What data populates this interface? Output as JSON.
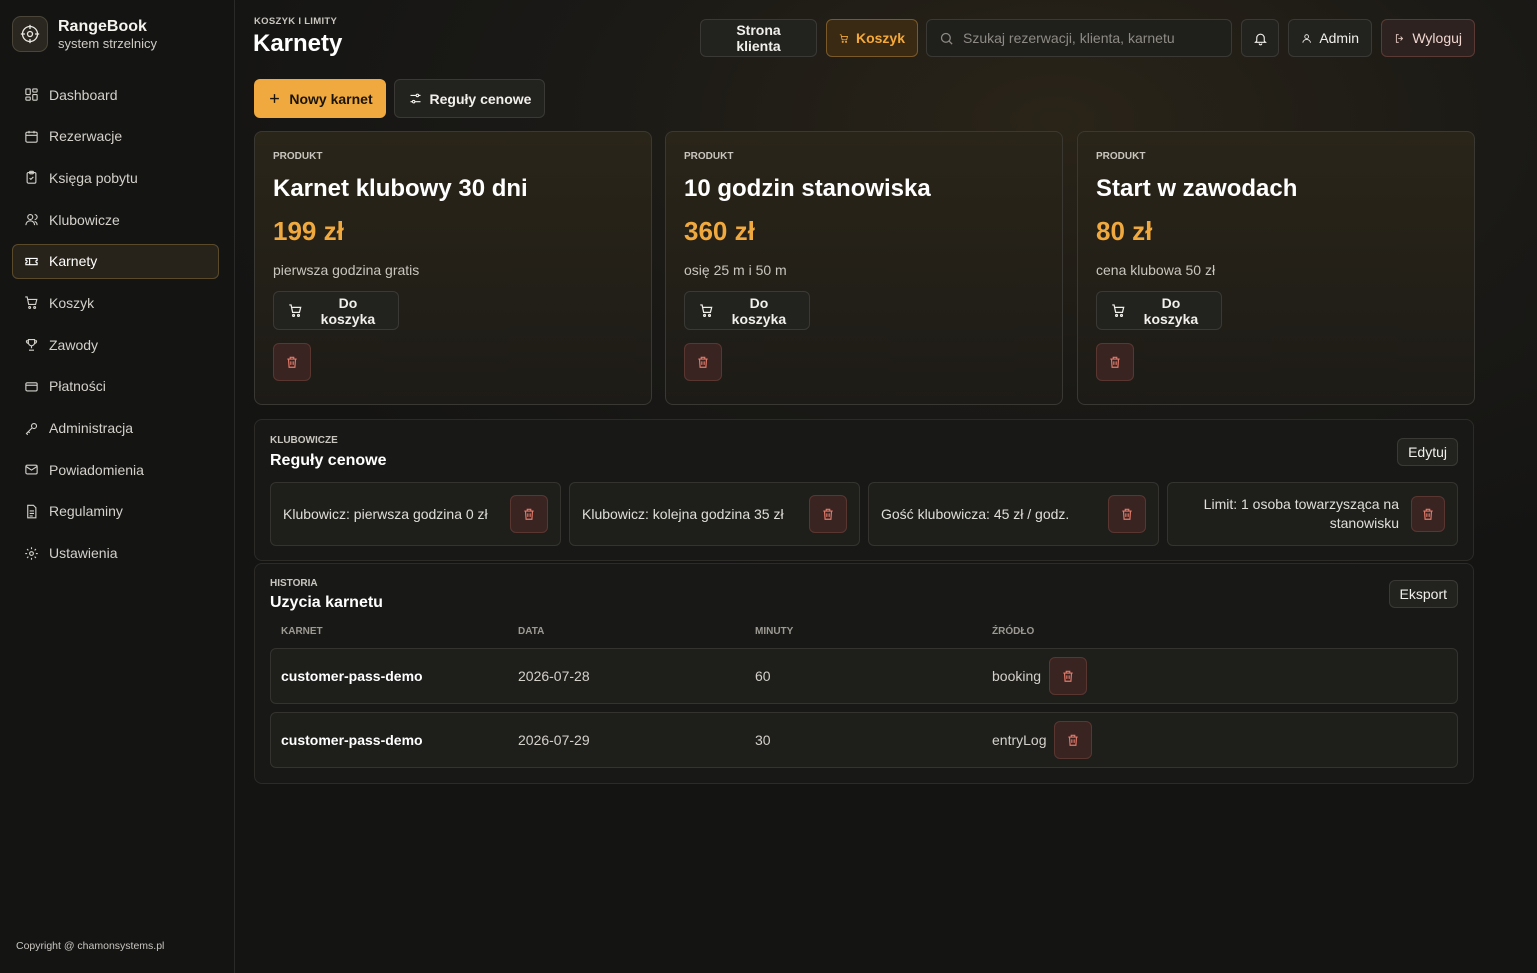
{
  "app": {
    "name": "RangeBook",
    "subtitle": "system strzelnicy"
  },
  "sidebar": {
    "items": [
      {
        "label": "Dashboard",
        "icon": "dashboard-icon"
      },
      {
        "label": "Rezerwacje",
        "icon": "calendar-icon"
      },
      {
        "label": "Księga pobytu",
        "icon": "clipboard-icon"
      },
      {
        "label": "Klubowicze",
        "icon": "user-icon"
      },
      {
        "label": "Karnety",
        "icon": "ticket-icon",
        "active": true
      },
      {
        "label": "Koszyk",
        "icon": "cart-icon"
      },
      {
        "label": "Zawody",
        "icon": "trophy-icon"
      },
      {
        "label": "Płatności",
        "icon": "wallet-icon"
      },
      {
        "label": "Administracja",
        "icon": "key-icon"
      },
      {
        "label": "Powiadomienia",
        "icon": "mail-icon"
      },
      {
        "label": "Regulaminy",
        "icon": "document-icon"
      },
      {
        "label": "Ustawienia",
        "icon": "gear-icon"
      }
    ],
    "copyright": "Copyright @ chamonsystems.pl"
  },
  "header": {
    "breadcrumb": "KOSZYK I LIMITY",
    "title": "Karnety",
    "client_button": "Strona klienta",
    "cart_button": "Koszyk",
    "search_placeholder": "Szukaj rezerwacji, klienta, karnetu",
    "admin_button": "Admin",
    "logout_button": "Wyloguj"
  },
  "actions": {
    "new_pass": "Nowy karnet",
    "price_rules": "Reguły cenowe"
  },
  "products": [
    {
      "kicker": "PRODUKT",
      "title": "Karnet klubowy 30 dni",
      "price": "199 zł",
      "description": "pierwsza godzina gratis",
      "add_label": "Do koszyka"
    },
    {
      "kicker": "PRODUKT",
      "title": "10 godzin stanowiska",
      "price": "360 zł",
      "description": "osię 25 m i 50 m",
      "add_label": "Do koszyka"
    },
    {
      "kicker": "PRODUKT",
      "title": "Start w zawodach",
      "price": "80 zł",
      "description": "cena klubowa 50 zł",
      "add_label": "Do koszyka"
    }
  ],
  "rules_panel": {
    "kicker": "KLUBOWICZE",
    "title": "Reguły cenowe",
    "edit_label": "Edytuj",
    "rules": [
      "Klubowicz: pierwsza godzina 0 zł",
      "Klubowicz: kolejna godzina 35 zł",
      "Gość klubowicza: 45 zł / godz.",
      "Limit: 1 osoba towarzysząca na stanowisku"
    ]
  },
  "history_panel": {
    "kicker": "HISTORIA",
    "title": "Uzycia karnetu",
    "export_label": "Eksport",
    "columns": [
      "KARNET",
      "DATA",
      "MINUTY",
      "ŹRÓDŁO"
    ],
    "rows": [
      {
        "pass": "customer-pass-demo",
        "date": "2026-07-28",
        "minutes": "60",
        "source": "booking"
      },
      {
        "pass": "customer-pass-demo",
        "date": "2026-07-29",
        "minutes": "30",
        "source": "entryLog"
      }
    ]
  },
  "colors": {
    "accent": "#f0a93e",
    "danger": "#e07a6a",
    "background": "#141413"
  }
}
